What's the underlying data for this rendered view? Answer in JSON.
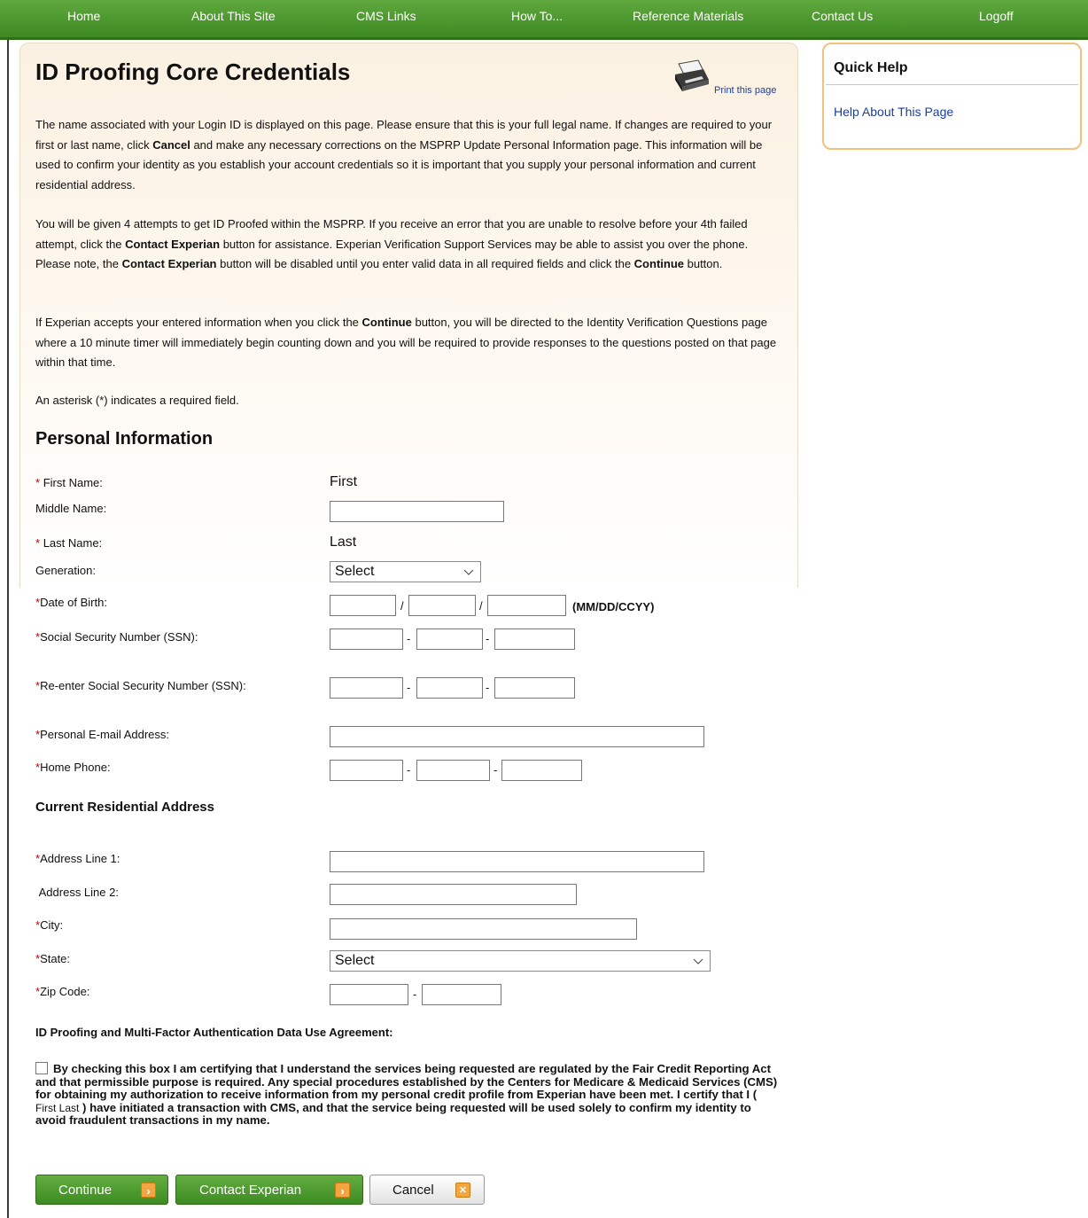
{
  "nav": {
    "items": [
      "Home",
      "About This Site",
      "CMS Links",
      "How To...",
      "Reference Materials",
      "Contact Us",
      "Logoff"
    ]
  },
  "page": {
    "title": "ID Proofing Core Credentials",
    "print_link": "Print this page"
  },
  "intro": {
    "p1_a": "The name associated with your Login ID is displayed on this page. Please ensure that this is your full legal name. If changes are required to your first or last name, click ",
    "p1_b": "Cancel",
    "p1_c": " and make any necessary corrections on the MSPRP Update Personal Information page. This information will be used to confirm your identity as you establish your account credentials so it is important that you supply your personal information and current residential address.",
    "p2_a": "You will be given 4 attempts to get ID Proofed within the MSPRP. If you receive an error that you are unable to resolve before your 4th failed attempt, click the ",
    "p2_b": "Contact Experian",
    "p2_c": " button for assistance. Experian Verification Support Services may be able to assist you over the phone. Please note, the ",
    "p2_d": "Contact Experian",
    "p2_e": " button will be disabled until you enter valid data in all required fields and click the ",
    "p2_f": "Continue",
    "p2_g": " button.",
    "p3_a": "If Experian accepts your entered information when you click the ",
    "p3_b": "Continue",
    "p3_c": " button, you will be directed to the Identity Verification Questions page where a 10 minute timer will immediately begin counting down and you will be required to provide responses to the questions posted on that page within that time.",
    "p4": "An asterisk (*) indicates a required field."
  },
  "personal": {
    "title": "Personal Information",
    "first_name_label": "First Name:",
    "first_name_value": "First",
    "middle_name_label": "Middle Name:",
    "middle_name_value": "",
    "last_name_label": "Last Name:",
    "last_name_value": "Last",
    "generation_label": "Generation:",
    "generation_value": "Select",
    "dob_label": "Date of Birth:",
    "dob_hint": "(MM/DD/CCYY)",
    "ssn_label": "Social Security Number (SSN):",
    "ssn_reenter_label": "Re-enter Social Security Number (SSN):",
    "email_label": "Personal E-mail Address:",
    "phone_label": "Home Phone:",
    "req_mark": "*",
    "slash": "/",
    "dash": "-"
  },
  "address": {
    "title": "Current Residential Address",
    "line1_label": "Address Line 1:",
    "line2_label": "Address Line 2:",
    "city_label": "City:",
    "state_label": "State:",
    "state_value": "Select",
    "zip_label": "Zip Code:"
  },
  "agreement": {
    "title": "ID Proofing and Multi-Factor Authentication Data Use Agreement:",
    "text_a": "By checking this box I am certifying that I understand the services being requested are regulated by the Fair Credit Reporting Act and that permissible purpose is required. Any special procedures established by the Centers for Medicare & Medicaid Services (CMS) for obtaining my authorization to receive information from my personal credit profile from Experian have been met. I certify that I ( ",
    "name": "First  Last",
    "text_b": "   ) have initiated a transaction with CMS, and that the service being requested will be used solely to confirm my identity to avoid fraudulent transactions in my name."
  },
  "buttons": {
    "continue": "Continue",
    "contact": "Contact Experian",
    "cancel": "Cancel"
  },
  "quick_help": {
    "title": "Quick Help",
    "link": "Help About This Page"
  },
  "colors": {
    "nav_green": "#4a9a2e",
    "link_blue": "#1a3f9a",
    "required_red": "#c00000",
    "quick_help_border": "#f0c27a",
    "button_icon_orange": "#f2a541"
  },
  "icons": [
    "printer-icon",
    "chevron-down-icon",
    "arrow-right-icon",
    "close-icon"
  ]
}
